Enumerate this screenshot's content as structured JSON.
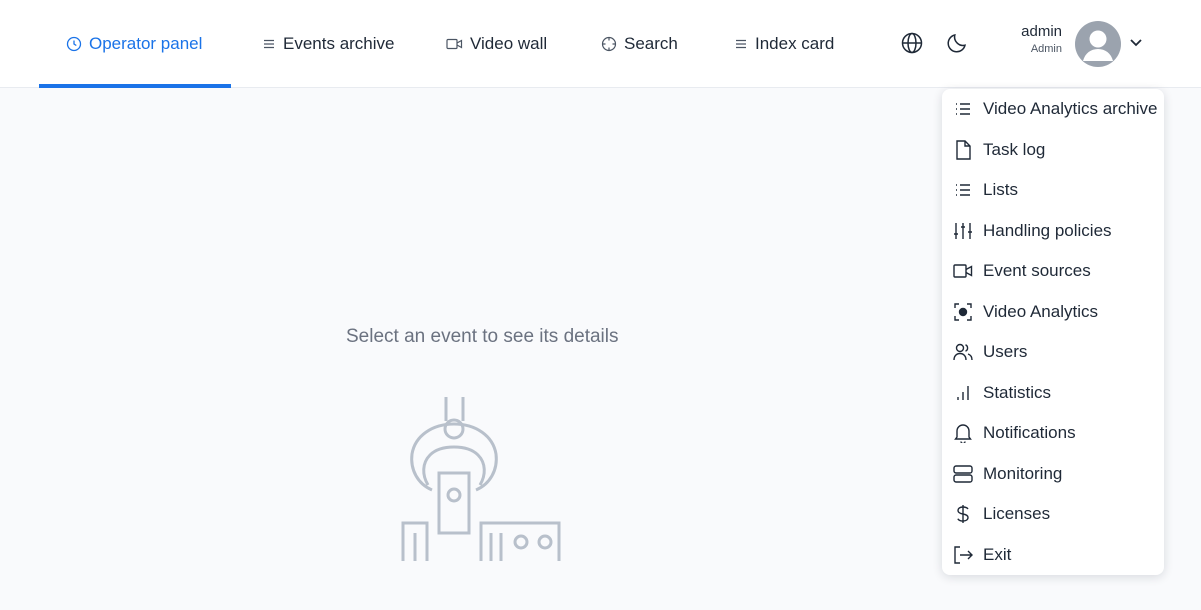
{
  "nav": {
    "items": [
      {
        "label": "Operator panel",
        "icon": "clock-icon",
        "active": true
      },
      {
        "label": "Events archive",
        "icon": "list-icon",
        "active": false
      },
      {
        "label": "Video wall",
        "icon": "video-camera-icon",
        "active": false
      },
      {
        "label": "Search",
        "icon": "crosshair-icon",
        "active": false
      },
      {
        "label": "Index card",
        "icon": "list-icon",
        "active": false
      }
    ],
    "accent_color": "#1a73e8"
  },
  "header": {
    "language_icon": "globe-icon",
    "theme_icon": "moon-icon"
  },
  "user": {
    "name": "admin",
    "role": "Admin"
  },
  "main": {
    "empty_message": "Select an event to see its details",
    "illustration_icon": "robotic-arm-illustration"
  },
  "menu": {
    "items": [
      {
        "label": "Video Analytics archive",
        "icon": "list-icon"
      },
      {
        "label": "Task log",
        "icon": "file-icon"
      },
      {
        "label": "Lists",
        "icon": "list-icon"
      },
      {
        "label": "Handling policies",
        "icon": "sliders-icon"
      },
      {
        "label": "Event sources",
        "icon": "video-camera-icon"
      },
      {
        "label": "Video Analytics",
        "icon": "focus-icon"
      },
      {
        "label": "Users",
        "icon": "users-icon"
      },
      {
        "label": "Statistics",
        "icon": "bar-chart-icon"
      },
      {
        "label": "Notifications",
        "icon": "bell-icon"
      },
      {
        "label": "Monitoring",
        "icon": "server-icon"
      },
      {
        "label": "Licenses",
        "icon": "dollar-icon"
      },
      {
        "label": "Exit",
        "icon": "logout-icon"
      }
    ]
  }
}
